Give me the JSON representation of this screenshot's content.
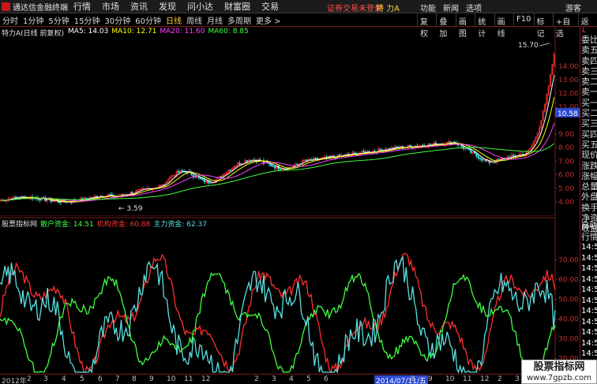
{
  "menubar": {
    "brand": "通达信金融终端",
    "menus": [
      "行情",
      "市场",
      "资讯",
      "发现",
      "问小达",
      "财富圈",
      "交易"
    ],
    "notice": "证券交易未登录",
    "stock_name": "特 力A",
    "right_menus": [
      "功能",
      "新闻",
      "选项"
    ],
    "guest": "游客"
  },
  "toolbar": {
    "periods": [
      "分时",
      "1分钟",
      "5分钟",
      "15分钟",
      "30分钟",
      "60分钟",
      "日线",
      "周线",
      "月线",
      "多周期",
      "更多 >"
    ],
    "active_period": "日线",
    "tools": [
      "复权",
      "叠加",
      "画图",
      "统计",
      "画线",
      "F10",
      "标记",
      "+自选",
      "返回"
    ]
  },
  "main": {
    "title": "特力A(日线 前复权)",
    "ma": [
      {
        "label": "MA5: 14.03",
        "color": "#ffffff"
      },
      {
        "label": "MA10: 12.71",
        "color": "#ffff00"
      },
      {
        "label": "MA20: 11.60",
        "color": "#ff40ff"
      },
      {
        "label": "MA60: 8.85",
        "color": "#40ff40"
      }
    ],
    "high_label": "15.70",
    "low_label": "3.59",
    "current_price": "10.58",
    "price_ticks": [
      "14.00",
      "13.00",
      "12.00",
      "11.00",
      "10.58",
      "9.00",
      "8.00",
      "7.00",
      "6.00",
      "5.00",
      "4.00"
    ]
  },
  "indicator": {
    "name": "股票指标网",
    "items": [
      {
        "label": "散户资金: 14.51",
        "color": "#40ff40"
      },
      {
        "label": "机构资金: 60.88",
        "color": "#ff3030"
      },
      {
        "label": "主力资金: 62.37",
        "color": "#5ae0e0"
      }
    ],
    "ticks": [
      "70.00",
      "60.00",
      "50.00",
      "40.00",
      "30.00",
      "20.00"
    ]
  },
  "timeaxis": {
    "labels": [
      "2012年",
      "2",
      "3",
      "4",
      "5",
      "6",
      "7",
      "8",
      "9",
      "10",
      "11",
      "12",
      "2",
      "3",
      "4",
      "5",
      "6",
      "2014/07/11/五",
      "8",
      "9",
      "10",
      "11",
      "12",
      "2",
      "3",
      "4",
      "5",
      "6"
    ]
  },
  "sidebar": {
    "title": "L",
    "rows": [
      "委比",
      "卖五",
      "卖四",
      "卖三",
      "卖二",
      "卖一",
      "买一",
      "买二",
      "买三",
      "买四",
      "买五",
      "现价",
      "涨跌",
      "涨幅",
      "总量",
      "外盘",
      "换手",
      "净资",
      "收益"
    ],
    "section": "自动",
    "section2": "行情",
    "times": [
      "14:56",
      "14:56",
      "14:56",
      "14:56",
      "14:56",
      "14:56",
      "14:56",
      "14:56",
      "14:56",
      "14:56",
      "14:56",
      "14:56",
      "14:56"
    ]
  },
  "watermark": {
    "title": "股票指标网",
    "url": "www.7gpzb.com"
  },
  "colors": {
    "up": "#ff3030",
    "down": "#40e0e0",
    "axis_border": "#7a1a1a",
    "price_box": "#2d4bd0"
  }
}
